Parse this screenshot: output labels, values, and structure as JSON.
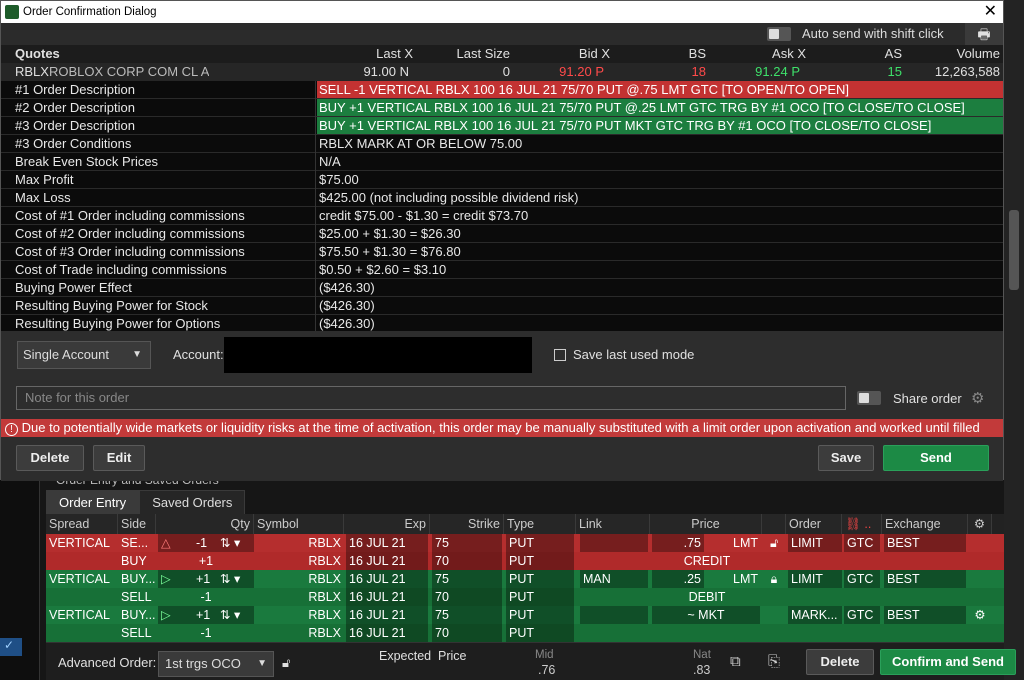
{
  "window": {
    "title": "Order Confirmation Dialog"
  },
  "autosend": {
    "label": "Auto send with shift click"
  },
  "quotes": {
    "headers": [
      "Quotes",
      "Last X",
      "Last Size",
      "Bid X",
      "BS",
      "Ask X",
      "AS",
      "Volume"
    ],
    "symbol": "RBLX",
    "name": "ROBLOX CORP COM CL A",
    "last": "91.00 N",
    "last_size": "0",
    "bid": "91.20 P",
    "bs": "18",
    "ask": "91.24 P",
    "as": "15",
    "volume": "12,263,588"
  },
  "order_rows": [
    {
      "label": "#1 Order Description",
      "value": "SELL -1 VERTICAL RBLX 100 16 JUL 21 75/70 PUT @.75 LMT GTC [TO OPEN/TO OPEN]"
    },
    {
      "label": "#2 Order Description",
      "value": "BUY +1 VERTICAL RBLX 100 16 JUL 21 75/70 PUT @.25 LMT GTC TRG BY #1 OCO [TO CLOSE/TO CLOSE]"
    },
    {
      "label": "#3 Order Description",
      "value": "BUY +1 VERTICAL RBLX 100 16 JUL 21 75/70 PUT MKT GTC TRG BY #1 OCO [TO CLOSE/TO CLOSE]"
    },
    {
      "label": "#3 Order Conditions",
      "value": "RBLX MARK AT OR BELOW 75.00"
    },
    {
      "label": "Break Even Stock Prices",
      "value": "N/A"
    },
    {
      "label": "Max Profit",
      "value": "$75.00"
    },
    {
      "label": "Max Loss",
      "value": "$425.00 (not including possible dividend risk)"
    },
    {
      "label": "Cost of #1 Order including commissions",
      "value": "credit $75.00 - $1.30 = credit $73.70"
    },
    {
      "label": "Cost of #2 Order including commissions",
      "value": "$25.00 + $1.30 = $26.30"
    },
    {
      "label": "Cost of #3 Order including commissions",
      "value": "$75.50 + $1.30 = $76.80"
    },
    {
      "label": "Cost of Trade including commissions",
      "value": "$0.50 + $2.60 = $3.10"
    },
    {
      "label": "Buying Power Effect",
      "value": "($426.30)"
    },
    {
      "label": "Resulting Buying Power for Stock",
      "value": "($426.30)"
    },
    {
      "label": "Resulting Buying Power for Options",
      "value": "($426.30)"
    }
  ],
  "account": {
    "mode": "Single Account",
    "label": "Account:",
    "save_mode": "Save last used mode",
    "note_placeholder": "Note for this order",
    "share": "Share order"
  },
  "warning": "Due to potentially wide markets or liquidity risks at the time of activation, this order may be manually substituted with a limit order upon activation and worked until filled",
  "dialog_buttons": {
    "delete": "Delete",
    "edit": "Edit",
    "save": "Save",
    "send": "Send"
  },
  "order_entry": {
    "header": "Order Entry and Saved Orders",
    "tabs": [
      "Order Entry",
      "Saved Orders"
    ],
    "columns": [
      "Spread",
      "Side",
      "Qty",
      "Symbol",
      "Exp",
      "Strike",
      "Type",
      "Link",
      "Price",
      "Order",
      "",
      "Exchange"
    ],
    "rows": [
      {
        "spread": "VERTICAL",
        "side": "SE...",
        "qty": "-1",
        "symbol": "RBLX",
        "exp": "16 JUL 21",
        "strike": "75",
        "type": "PUT",
        "link": "",
        "price": ".75",
        "ptype": "LMT",
        "order": "LIMIT",
        "tif": "GTC",
        "exch": "BEST"
      },
      {
        "spread": "",
        "side": "BUY",
        "qty": "+1",
        "symbol": "RBLX",
        "exp": "16 JUL 21",
        "strike": "70",
        "type": "PUT",
        "link": "",
        "price": "CREDIT",
        "ptype": "",
        "order": "",
        "tif": "",
        "exch": ""
      },
      {
        "spread": "VERTICAL",
        "side": "BUY...",
        "qty": "+1",
        "symbol": "RBLX",
        "exp": "16 JUL 21",
        "strike": "75",
        "type": "PUT",
        "link": "MAN",
        "price": ".25",
        "ptype": "LMT",
        "order": "LIMIT",
        "tif": "GTC",
        "exch": "BEST"
      },
      {
        "spread": "",
        "side": "SELL",
        "qty": "-1",
        "symbol": "RBLX",
        "exp": "16 JUL 21",
        "strike": "70",
        "type": "PUT",
        "link": "",
        "price": "DEBIT",
        "ptype": "",
        "order": "",
        "tif": "",
        "exch": ""
      },
      {
        "spread": "VERTICAL",
        "side": "BUY...",
        "qty": "+1",
        "symbol": "RBLX",
        "exp": "16 JUL 21",
        "strike": "75",
        "type": "PUT",
        "link": "",
        "price": "~ MKT",
        "ptype": "",
        "order": "MARK...",
        "tif": "GTC",
        "exch": "BEST"
      },
      {
        "spread": "",
        "side": "SELL",
        "qty": "-1",
        "symbol": "RBLX",
        "exp": "16 JUL 21",
        "strike": "70",
        "type": "PUT",
        "link": "",
        "price": "",
        "ptype": "",
        "order": "",
        "tif": "",
        "exch": ""
      }
    ]
  },
  "bottom": {
    "advanced_label": "Advanced Order:",
    "advanced_value": "1st trgs OCO",
    "expected": "Expected",
    "price": "Price",
    "mid_label": "Mid",
    "mid_value": ".76",
    "nat_label": "Nat",
    "nat_value": ".83",
    "delete": "Delete",
    "confirm": "Confirm and Send"
  }
}
